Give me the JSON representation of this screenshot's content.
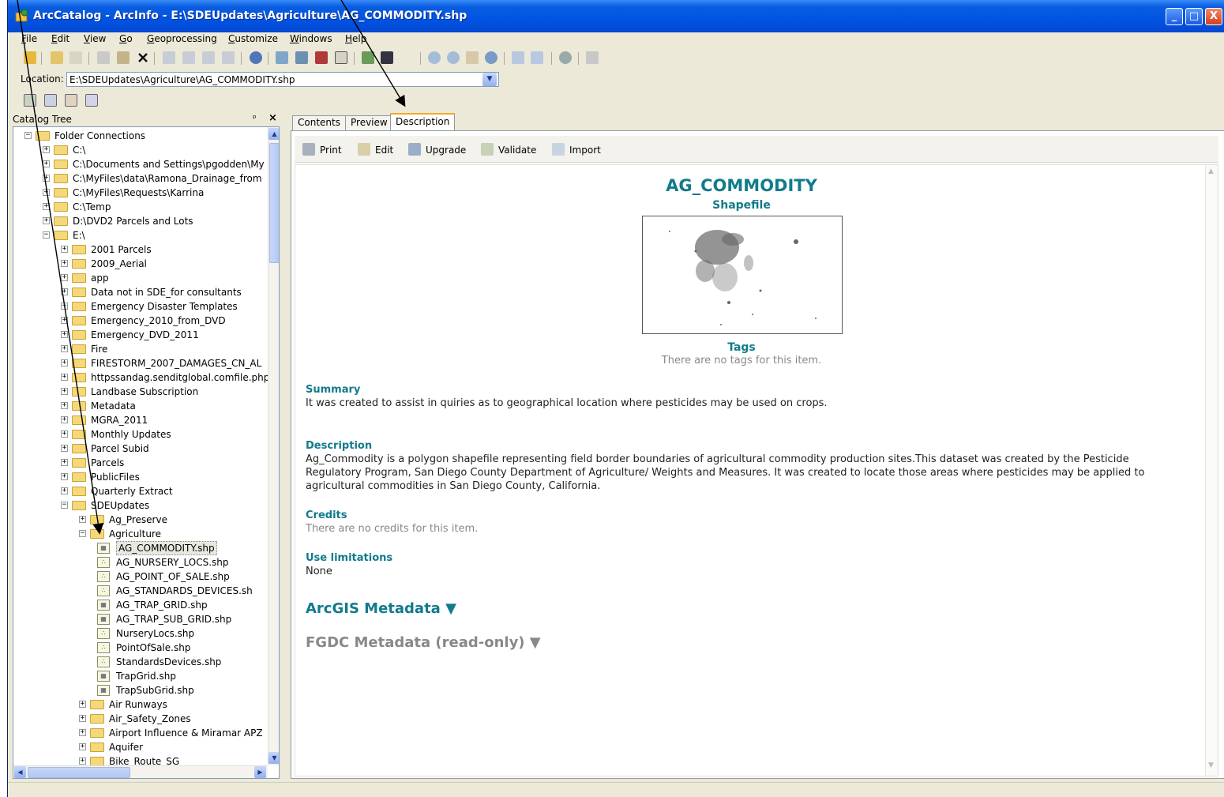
{
  "window": {
    "title": "ArcCatalog - ArcInfo - E:\\SDEUpdates\\Agriculture\\AG_COMMODITY.shp",
    "minimize": "_",
    "maximize": "□",
    "close": "X"
  },
  "menu": [
    "File",
    "Edit",
    "View",
    "Go",
    "Geoprocessing",
    "Customize",
    "Windows",
    "Help"
  ],
  "location": {
    "label": "Location:",
    "value": "E:\\SDEUpdates\\Agriculture\\AG_COMMODITY.shp"
  },
  "tree": {
    "title": "Catalog Tree",
    "pin": "ᵖ",
    "close": "×",
    "rows": [
      {
        "label": "Folder Connections",
        "exp": "−",
        "kind": "folder"
      },
      {
        "label": "C:\\",
        "exp": "+",
        "kind": "folder"
      },
      {
        "label": "C:\\Documents and Settings\\pgodden\\My I",
        "exp": "+",
        "kind": "folder"
      },
      {
        "label": "C:\\MyFiles\\data\\Ramona_Drainage_from",
        "exp": "+",
        "kind": "folder"
      },
      {
        "label": "C:\\MyFiles\\Requests\\Karrina",
        "exp": "+",
        "kind": "folder"
      },
      {
        "label": "C:\\Temp",
        "exp": "+",
        "kind": "folder"
      },
      {
        "label": "D:\\DVD2 Parcels and Lots",
        "exp": "+",
        "kind": "folder"
      },
      {
        "label": "E:\\",
        "exp": "−",
        "kind": "folder"
      },
      {
        "label": "2001 Parcels",
        "exp": "+",
        "kind": "folder"
      },
      {
        "label": "2009_Aerial",
        "exp": "+",
        "kind": "folder"
      },
      {
        "label": "app",
        "exp": "+",
        "kind": "folder"
      },
      {
        "label": "Data not in SDE_for consultants",
        "exp": "+",
        "kind": "folder"
      },
      {
        "label": "Emergency Disaster Templates",
        "exp": "+",
        "kind": "folder"
      },
      {
        "label": "Emergency_2010_from_DVD",
        "exp": "+",
        "kind": "folder"
      },
      {
        "label": "Emergency_DVD_2011",
        "exp": "+",
        "kind": "folder"
      },
      {
        "label": "Fire",
        "exp": "+",
        "kind": "folder"
      },
      {
        "label": "FIRESTORM_2007_DAMAGES_CN_AL",
        "exp": "+",
        "kind": "folder"
      },
      {
        "label": "httpssandag.senditglobal.comfile.php",
        "exp": "+",
        "kind": "folder"
      },
      {
        "label": "Landbase Subscription",
        "exp": "+",
        "kind": "folder"
      },
      {
        "label": "Metadata",
        "exp": "+",
        "kind": "folder"
      },
      {
        "label": "MGRA_2011",
        "exp": "+",
        "kind": "folder"
      },
      {
        "label": "Monthly Updates",
        "exp": "+",
        "kind": "folder"
      },
      {
        "label": "Parcel Subid",
        "exp": "+",
        "kind": "folder"
      },
      {
        "label": "Parcels",
        "exp": "+",
        "kind": "folder"
      },
      {
        "label": "PublicFiles",
        "exp": "+",
        "kind": "folder"
      },
      {
        "label": "Quarterly Extract",
        "exp": "+",
        "kind": "folder"
      },
      {
        "label": "SDEUpdates",
        "exp": "−",
        "kind": "folder"
      },
      {
        "label": "Ag_Preserve",
        "exp": "+",
        "kind": "folder"
      },
      {
        "label": "Agriculture",
        "exp": "−",
        "kind": "folder"
      },
      {
        "label": "AG_COMMODITY.shp",
        "exp": "",
        "kind": "poly",
        "selected": true
      },
      {
        "label": "AG_NURSERY_LOCS.shp",
        "exp": "",
        "kind": "point"
      },
      {
        "label": "AG_POINT_OF_SALE.shp",
        "exp": "",
        "kind": "point"
      },
      {
        "label": "AG_STANDARDS_DEVICES.sh",
        "exp": "",
        "kind": "point"
      },
      {
        "label": "AG_TRAP_GRID.shp",
        "exp": "",
        "kind": "poly"
      },
      {
        "label": "AG_TRAP_SUB_GRID.shp",
        "exp": "",
        "kind": "poly"
      },
      {
        "label": "NurseryLocs.shp",
        "exp": "",
        "kind": "point"
      },
      {
        "label": "PointOfSale.shp",
        "exp": "",
        "kind": "point"
      },
      {
        "label": "StandardsDevices.shp",
        "exp": "",
        "kind": "point"
      },
      {
        "label": "TrapGrid.shp",
        "exp": "",
        "kind": "poly"
      },
      {
        "label": "TrapSubGrid.shp",
        "exp": "",
        "kind": "poly"
      },
      {
        "label": "Air Runways",
        "exp": "+",
        "kind": "folder"
      },
      {
        "label": "Air_Safety_Zones",
        "exp": "+",
        "kind": "folder"
      },
      {
        "label": "Airport Influence & Miramar APZ",
        "exp": "+",
        "kind": "folder"
      },
      {
        "label": "Aquifer",
        "exp": "+",
        "kind": "folder"
      },
      {
        "label": "Bike_Route_SG",
        "exp": "+",
        "kind": "folder"
      }
    ]
  },
  "tabs": [
    "Contents",
    "Preview",
    "Description"
  ],
  "active_tab": "Description",
  "content_toolbar": [
    "Print",
    "Edit",
    "Upgrade",
    "Validate",
    "Import"
  ],
  "description": {
    "name": "AG_COMMODITY",
    "type": "Shapefile",
    "tags_heading": "Tags",
    "tags_text": "There are no tags for this item.",
    "summary_heading": "Summary",
    "summary_text": "It was created to assist in quiries as to geographical location where pesticides may be used on crops.",
    "description_heading": "Description",
    "description_text": "Ag_Commodity is a polygon shapefile representing field border boundaries of agricultural commodity production sites.This dataset was created by the Pesticide Regulatory Program, San Diego County Department of Agriculture/ Weights and Measures. It was created to locate those areas where pesticides may be applied to agricultural commodities in San Diego County, California.",
    "credits_heading": "Credits",
    "credits_text": "There are no credits for this item.",
    "use_heading": "Use limitations",
    "use_text": "None",
    "arcgis_meta": "ArcGIS Metadata ▼",
    "fgdc_meta": "FGDC Metadata (read-only) ▼"
  },
  "colors": {
    "accent_teal": "#117b8b",
    "titlebar_blue": "#0054e3"
  }
}
